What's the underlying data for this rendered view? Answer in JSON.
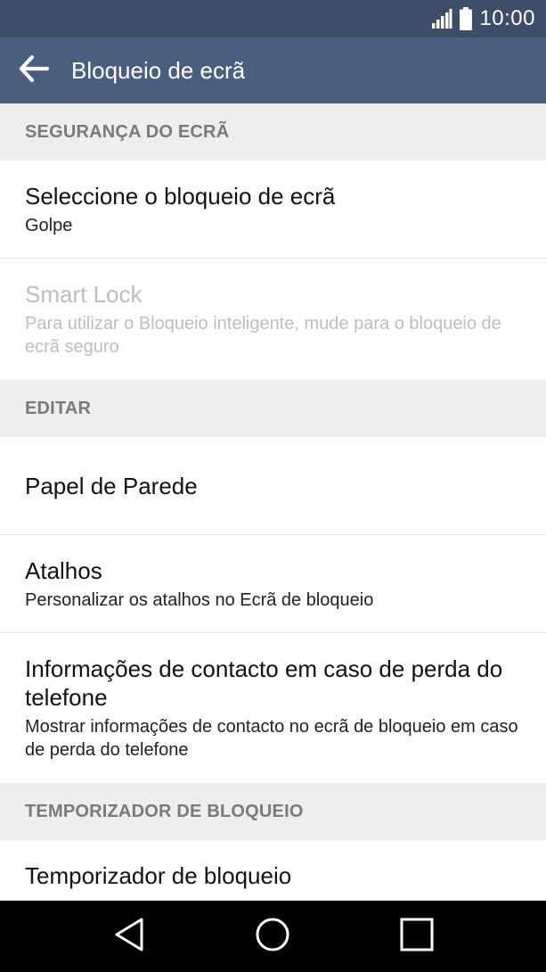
{
  "status_bar": {
    "time": "10:00",
    "icons": [
      "signal-icon",
      "battery-icon"
    ]
  },
  "app_bar": {
    "title": "Bloqueio de ecrã",
    "back_icon": "arrow-left-icon"
  },
  "sections": [
    {
      "header": "SEGURANÇA DO ECRÃ",
      "items": [
        {
          "title": "Seleccione o bloqueio de ecrã",
          "subtitle": "Golpe",
          "enabled": true
        },
        {
          "title": "Smart Lock",
          "subtitle": "Para utilizar o Bloqueio inteligente, mude para o bloqueio de ecrã seguro",
          "enabled": false
        }
      ]
    },
    {
      "header": "EDITAR",
      "items": [
        {
          "title": "Papel de Parede",
          "enabled": true
        },
        {
          "title": "Atalhos",
          "subtitle": "Personalizar os atalhos no Ecrã de bloqueio",
          "enabled": true
        },
        {
          "title": "Informações de contacto em caso de perda do telefone",
          "subtitle": "Mostrar informações de contacto no ecrã de bloqueio em caso de perda do telefone",
          "enabled": true
        }
      ]
    },
    {
      "header": "TEMPORIZADOR DE BLOQUEIO",
      "items": [
        {
          "title": "Temporizador de bloqueio",
          "enabled": true
        }
      ]
    }
  ],
  "nav_bar": {
    "icons": [
      "back-triangle-icon",
      "home-circle-icon",
      "recents-square-icon"
    ]
  },
  "colors": {
    "status_bar": "#3e4e68",
    "app_bar": "#4a5f7f",
    "section_header_bg": "#eeeeee",
    "section_header_text": "#7a7a7a",
    "disabled_text": "#bdbdbd",
    "nav_bar": "#000000"
  }
}
